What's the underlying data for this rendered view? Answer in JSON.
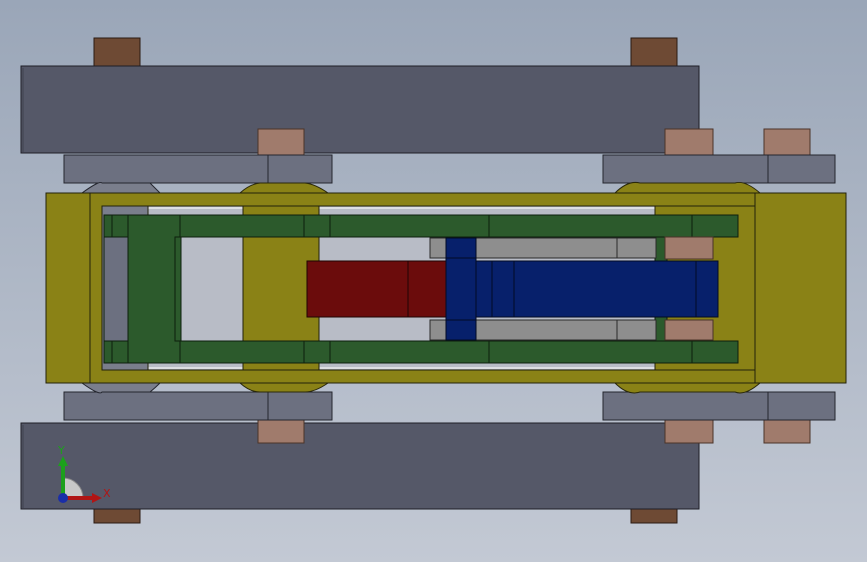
{
  "scene": {
    "type": "cad-model-view",
    "view": "top",
    "background_top": "#9aa6b8",
    "background_bottom": "#c3c9d4"
  },
  "part_colors": {
    "rail": "#555868",
    "bracket": "#6c7080",
    "pin": "#6e4a34",
    "bushing": "#a07b6c",
    "yoke": "#8a8216",
    "frame": "#2c5a2c",
    "piston": "#6b0c0c",
    "cylinder": "#07206b",
    "rod_guide": "#8e8e8e"
  },
  "triad": {
    "x_label": "X",
    "y_label": "Y",
    "x_color": "#b01515",
    "y_color": "#1ca01c",
    "z_color": "#1a2ea8"
  }
}
